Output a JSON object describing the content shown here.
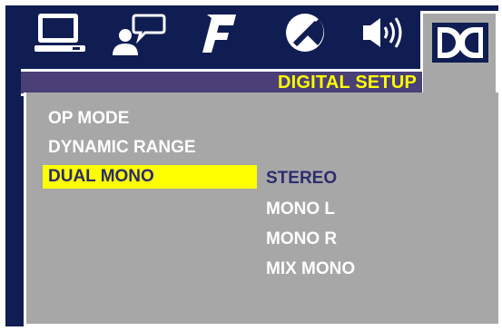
{
  "title": "DIGITAL SETUP",
  "tabs": [
    {
      "icon": "monitor-icon"
    },
    {
      "icon": "language-speech-icon"
    },
    {
      "icon": "music-note-icon"
    },
    {
      "icon": "picture-contrast-icon"
    },
    {
      "icon": "speaker-icon"
    },
    {
      "icon": "dolby-digital-icon",
      "active": true
    }
  ],
  "menu": {
    "items": [
      "OP MODE",
      "DYNAMIC RANGE",
      "DUAL MONO"
    ],
    "selected_index": 2
  },
  "options": {
    "items": [
      "STEREO",
      "MONO L",
      "MONO R",
      "MIX MONO"
    ],
    "selected_index": 0
  },
  "colors": {
    "background": "#0f1d52",
    "panel": "#a7a7a7",
    "highlight": "#ffff00",
    "title_strip": "#4a3f77",
    "selected_text": "#2d2d6e"
  }
}
